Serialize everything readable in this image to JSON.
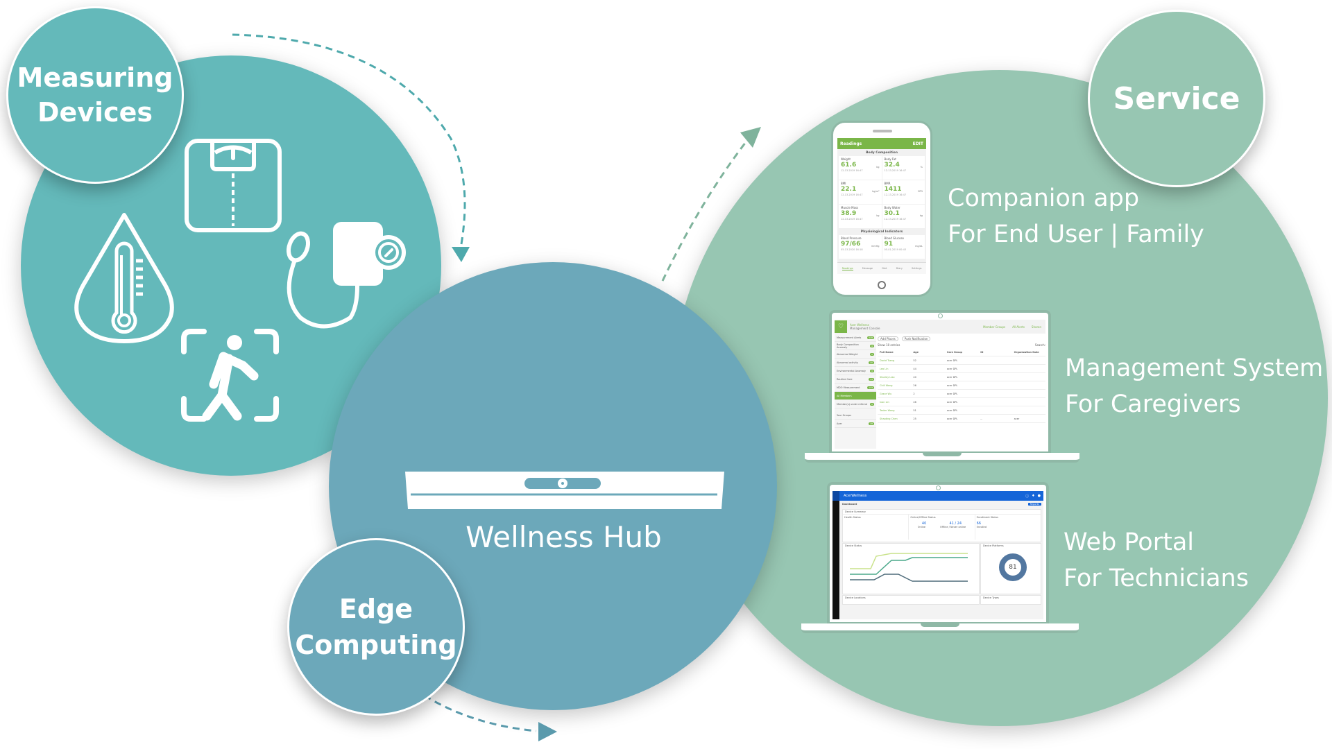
{
  "diagram": {
    "nodes": {
      "measuring_devices": {
        "label_line1": "Measuring",
        "label_line2": "Devices",
        "color": "#64b9ba",
        "icons": [
          "weight-scale-icon",
          "thermometer-drop-icon",
          "blood-pressure-monitor-icon",
          "gait-detection-icon"
        ]
      },
      "wellness_hub": {
        "label": "Wellness Hub",
        "color": "#6ca8ba",
        "icon": "hub-device-icon"
      },
      "edge_computing": {
        "label_line1": "Edge",
        "label_line2": "Computing",
        "color": "#6ca8ba"
      },
      "service": {
        "label": "Service",
        "color": "#97c6b2",
        "items": [
          {
            "line1": "Companion app",
            "line2": "For End User | Family"
          },
          {
            "line1": "Management System",
            "line2": "For Caregivers"
          },
          {
            "line1": "Web Portal",
            "line2": "For Technicians"
          }
        ]
      }
    },
    "edges": [
      {
        "from": "measuring_devices",
        "to": "wellness_hub",
        "style": "dashed-arrow"
      },
      {
        "from": "wellness_hub",
        "to": "service",
        "style": "dashed-arrow"
      },
      {
        "from": "edge_computing",
        "to": "wellness_hub",
        "style": "dashed-arrow"
      }
    ]
  },
  "companion_app": {
    "header_title": "Readings",
    "header_action": "EDIT",
    "section1": "Body Composition",
    "cards": [
      {
        "title": "Weight",
        "value": "61.6",
        "unit": "kg",
        "date": "12-13-2019 16:47"
      },
      {
        "title": "Body Fat",
        "value": "32.4",
        "unit": "%",
        "date": "12-13-2019 16:47"
      },
      {
        "title": "BMI",
        "value": "22.1",
        "unit": "kg/m²",
        "date": "12-13-2019 16:47"
      },
      {
        "title": "BMR",
        "value": "1411",
        "unit": "CPD",
        "date": "12-13-2019 16:47"
      },
      {
        "title": "Muscle Mass",
        "value": "38.9",
        "unit": "kg",
        "date": "12-13-2019 16:47"
      },
      {
        "title": "Body Water",
        "value": "30.1",
        "unit": "kg",
        "date": "12-13-2019 16:47"
      }
    ],
    "section2": "Physiological Indicators",
    "cards2": [
      {
        "title": "Blood Pressure",
        "value": "97/66",
        "unit": "mmHg",
        "date": "05-13-2020 16:18"
      },
      {
        "title": "Blood Glucose",
        "value": "91",
        "unit": "mg/dL",
        "date": "05-01-2019 00:43"
      }
    ],
    "nav": [
      "Readings",
      "Message",
      "Diet",
      "Diary",
      "Settings"
    ]
  },
  "management_system": {
    "brand_line1": "Acer Wellness",
    "brand_line2": "Management Console",
    "tabs": [
      "Member Groups",
      "All Alerts"
    ],
    "user": "Sharon",
    "sidebar": [
      {
        "label": "Measurement Alerts",
        "count": "528"
      },
      {
        "label": "Body Composition Anomaly",
        "count": "0"
      },
      {
        "label": "Abnormal Weight",
        "count": "0"
      },
      {
        "label": "Abnormal activity",
        "count": "20"
      },
      {
        "label": "Environmental Anomaly",
        "count": "0"
      },
      {
        "label": "Routine Care",
        "count": "44"
      },
      {
        "label": "MDO Measurement",
        "count": "133"
      },
      {
        "label": "All Members",
        "count": ""
      },
      {
        "label": "Member(s) under referral",
        "count": "0"
      }
    ],
    "groups_title": "Your Groups",
    "groups": [
      {
        "label": "Acer",
        "count": "28"
      }
    ],
    "buttons": [
      "Add Places",
      "Push Notification"
    ],
    "show_label": "Show 10 entries",
    "search_label": "Search:",
    "columns": [
      "Full Name",
      "Age",
      "Care Group",
      "ID",
      "Organization Note"
    ],
    "rows": [
      {
        "name": "David Tseng",
        "age": "52",
        "group": "acer DPL"
      },
      {
        "name": "Leo Lin",
        "age": "44",
        "group": "acer DPL"
      },
      {
        "name": "Stanley Liao",
        "age": "40",
        "group": "acer DPL"
      },
      {
        "name": "Chill Wang",
        "age": "26",
        "group": "acer DPL"
      },
      {
        "name": "Grace Wu",
        "age": "2",
        "group": "acer DPL"
      },
      {
        "name": "Ivan Lin",
        "age": "46",
        "group": "acer DPL"
      },
      {
        "name": "Tester Wang",
        "age": "51",
        "group": "acer DPL"
      },
      {
        "name": "Shaoting Chen",
        "age": "25",
        "group": "acer DPL",
        "id": "--",
        "note": "acer"
      }
    ]
  },
  "web_portal": {
    "brand": "AcerWellness",
    "page_title": "Dashboard",
    "action_button": "Reports",
    "device_summary_title": "Device Summary",
    "panels": [
      "Health Status",
      "Online/Offline Status",
      "Enrollment Status"
    ],
    "online": "40",
    "online_label": "Online",
    "offline": "41 / 24",
    "offline_label": "Offline / Never online",
    "enrolled": "66",
    "enrolled_label": "Enrolled",
    "device_status_title": "Device Status",
    "device_platforms_title": "Device Platforms",
    "donut_value": "81",
    "device_locations_title": "Device Locations",
    "device_types_title": "Device Types"
  }
}
